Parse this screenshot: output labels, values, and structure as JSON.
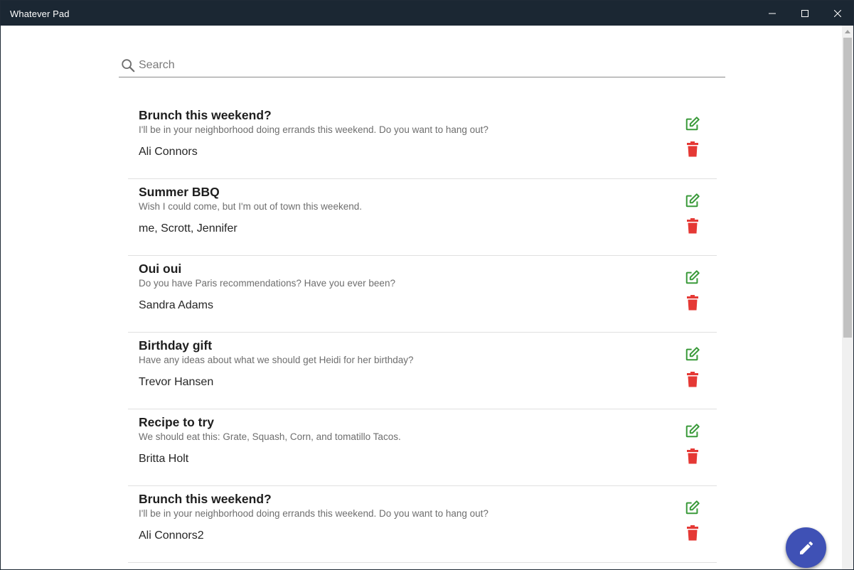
{
  "window": {
    "title": "Whatever Pad"
  },
  "search": {
    "placeholder": "Search",
    "value": ""
  },
  "colors": {
    "titlebar": "#1b2733",
    "edit_icon": "#3a9a3a",
    "delete_icon": "#e53935",
    "fab": "#3f51b5"
  },
  "notes": [
    {
      "title": "Brunch this weekend?",
      "body": "I'll be in your neighborhood doing errands this weekend. Do you want to hang out?",
      "author": "Ali Connors"
    },
    {
      "title": "Summer BBQ",
      "body": "Wish I could come, but I'm out of town this weekend.",
      "author": "me, Scrott, Jennifer"
    },
    {
      "title": "Oui oui",
      "body": "Do you have Paris recommendations? Have you ever been?",
      "author": "Sandra Adams"
    },
    {
      "title": "Birthday gift",
      "body": "Have any ideas about what we should get Heidi for her birthday?",
      "author": "Trevor Hansen"
    },
    {
      "title": "Recipe to try",
      "body": "We should eat this: Grate, Squash, Corn, and tomatillo Tacos.",
      "author": "Britta Holt"
    },
    {
      "title": "Brunch this weekend?",
      "body": "I'll be in your neighborhood doing errands this weekend. Do you want to hang out?",
      "author": "Ali Connors2"
    }
  ],
  "icons": {
    "search": "search-icon",
    "edit": "edit-note-icon",
    "delete": "trash-icon",
    "fab": "pencil-icon",
    "minimize": "minimize-icon",
    "maximize": "maximize-icon",
    "close": "close-icon"
  }
}
